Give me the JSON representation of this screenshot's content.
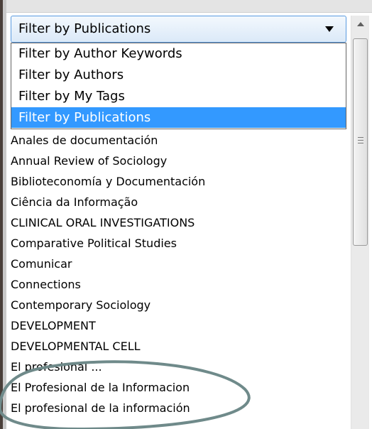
{
  "filter": {
    "selected_label": "Filter by Publications",
    "options": [
      "Filter by Author Keywords",
      "Filter by Authors",
      "Filter by My Tags",
      "Filter by Publications"
    ],
    "selected_index": 3
  },
  "publications": [
    "Anales de documentación",
    "Annual Review of Sociology",
    "Biblioteconomía y Documentación",
    "Ciência da Informação",
    "CLINICAL ORAL INVESTIGATIONS",
    "Comparative Political Studies",
    "Comunicar",
    "Connections",
    "Contemporary Sociology",
    "DEVELOPMENT",
    "DEVELOPMENTAL CELL",
    "El profesional ...",
    "El Profesional de la Informacion",
    "El profesional de la información"
  ],
  "colors": {
    "selection": "#3399ff",
    "annotation_ellipse": "#6f8a8a"
  },
  "icons": {
    "dropdown_arrow": "triangle-down",
    "scroll_up": "triangle-up",
    "scroll_grip": "three-lines"
  }
}
